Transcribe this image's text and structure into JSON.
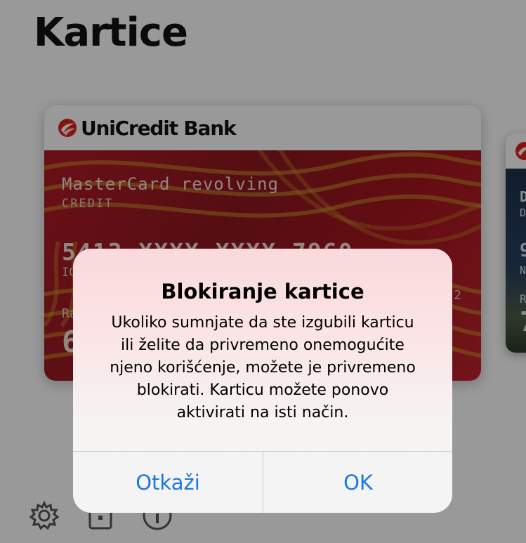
{
  "page": {
    "title": "Kartice"
  },
  "card": {
    "bank_name": "UniCredit Bank",
    "name": "MasterCard revolving",
    "type": "CREDIT",
    "number": "5413 XXXX XXXX 7960",
    "holder_partial": "IG",
    "label_partial": "Ra",
    "amount_partial": "6",
    "mini_partial": "2",
    "pattern_color": "#d19a2a"
  },
  "card2": {
    "line1": "D",
    "line2": "D",
    "line3": "9",
    "line4": "N",
    "line5": "R",
    "line6": "7"
  },
  "toolbar": {
    "icons": [
      "gear-icon",
      "card-lock-icon",
      "info-icon"
    ]
  },
  "alert": {
    "title": "Blokiranje kartice",
    "message_lines": [
      "Ukoliko sumnjate da ste izgubili karticu",
      "ili želite da privremeno onemogućite",
      "njeno korišćenje, možete je privremeno",
      "blokirati. Karticu možete ponovo",
      "aktivirati na isti način."
    ],
    "cancel_label": "Otkaži",
    "ok_label": "OK",
    "button_color": "#1e78e0"
  }
}
